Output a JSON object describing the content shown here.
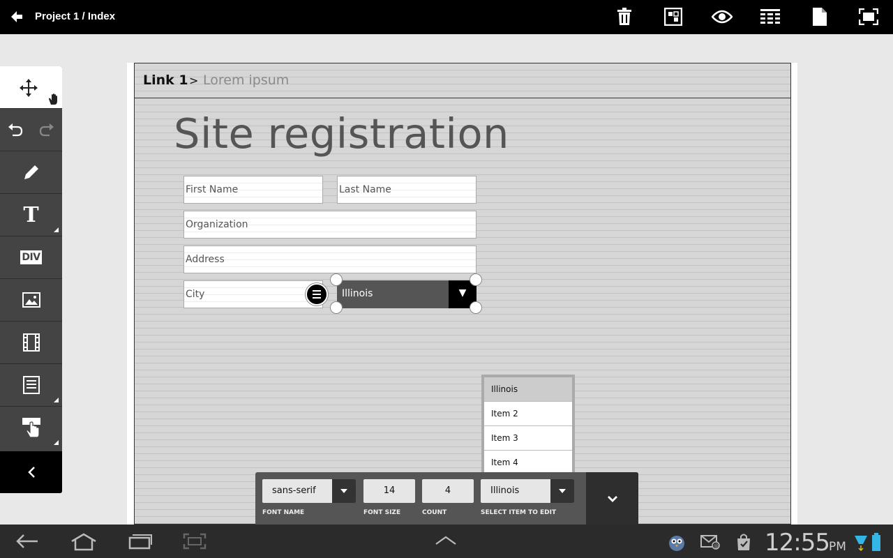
{
  "app": {
    "title": "Project 1 / Index",
    "toolbar_icons": [
      "trash-icon",
      "grid-view-icon",
      "preview-eye-icon",
      "table-view-icon",
      "page-icon",
      "fullscreen-icon"
    ]
  },
  "tools": [
    "move-icon",
    "undo-icon",
    "redo-icon",
    "pencil-icon",
    "text-tool-icon",
    "div-tool-icon",
    "image-tool-icon",
    "video-tool-icon",
    "form-tool-icon",
    "button-tool-icon",
    "collapse-icon"
  ],
  "tool_labels": {
    "text": "T",
    "div": "DIV"
  },
  "canvas": {
    "breadcrumb": {
      "link": "Link 1",
      "separator": ">",
      "current": "Lorem ipsum"
    },
    "heading": "Site registration",
    "fields": {
      "first_name": "First Name",
      "last_name": "Last Name",
      "organization": "Organization",
      "address": "Address",
      "city": "City"
    },
    "select": {
      "value": "Illinois",
      "arrow": "▼"
    }
  },
  "dropdown": {
    "items": [
      "Illinois",
      "Item 2",
      "Item 3",
      "Item 4"
    ],
    "selected": "Illinois"
  },
  "properties": {
    "font_name": {
      "value": "sans-serif",
      "label": "FONT NAME"
    },
    "font_size": {
      "value": "14",
      "label": "FONT SIZE"
    },
    "count": {
      "value": "4",
      "label": "COUNT"
    },
    "select_item": {
      "value": "Illinois",
      "label": "SELECT ITEM TO EDIT"
    }
  },
  "system": {
    "time": "12:55",
    "ampm": "PM",
    "icons": [
      "nav-back-icon",
      "nav-home-icon",
      "recent-apps-icon",
      "screenshot-icon",
      "expand-up-icon",
      "bird-notification-icon",
      "email-icon",
      "shopping-bag-icon",
      "wifi-icon",
      "battery-icon"
    ]
  },
  "colors": {
    "topbar": "#000000",
    "canvas": "#d6d6d6",
    "toolbar": "#444444",
    "system_bar": "#2b2b2b"
  }
}
